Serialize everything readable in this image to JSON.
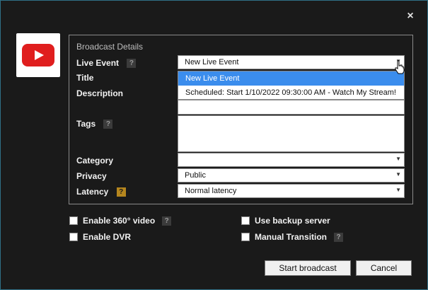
{
  "close_label": "×",
  "section": {
    "title": "Broadcast Details"
  },
  "fields": {
    "live_event": {
      "label": "Live Event",
      "help": "?",
      "value": "New Live Event"
    },
    "title": {
      "label": "Title"
    },
    "description": {
      "label": "Description"
    },
    "tags": {
      "label": "Tags",
      "help": "?"
    },
    "category": {
      "label": "Category",
      "value": ""
    },
    "privacy": {
      "label": "Privacy",
      "value": "Public"
    },
    "latency": {
      "label": "Latency",
      "help": "?",
      "value": "Normal latency"
    }
  },
  "dropdown": {
    "options": [
      "New Live Event",
      "Scheduled: Start 1/10/2022 09:30:00 AM - Watch My Stream!"
    ]
  },
  "checkboxes": {
    "enable_360": {
      "label": "Enable 360° video",
      "help": "?"
    },
    "enable_dvr": {
      "label": "Enable DVR"
    },
    "use_backup": {
      "label": "Use backup server"
    },
    "manual_transition": {
      "label": "Manual Transition",
      "help": "?"
    }
  },
  "buttons": {
    "start": "Start broadcast",
    "cancel": "Cancel"
  },
  "colors": {
    "accent": "#3b8ded",
    "border": "#2f6f86",
    "brand_red": "#e01e1e",
    "help_gold": "#b5861e"
  }
}
